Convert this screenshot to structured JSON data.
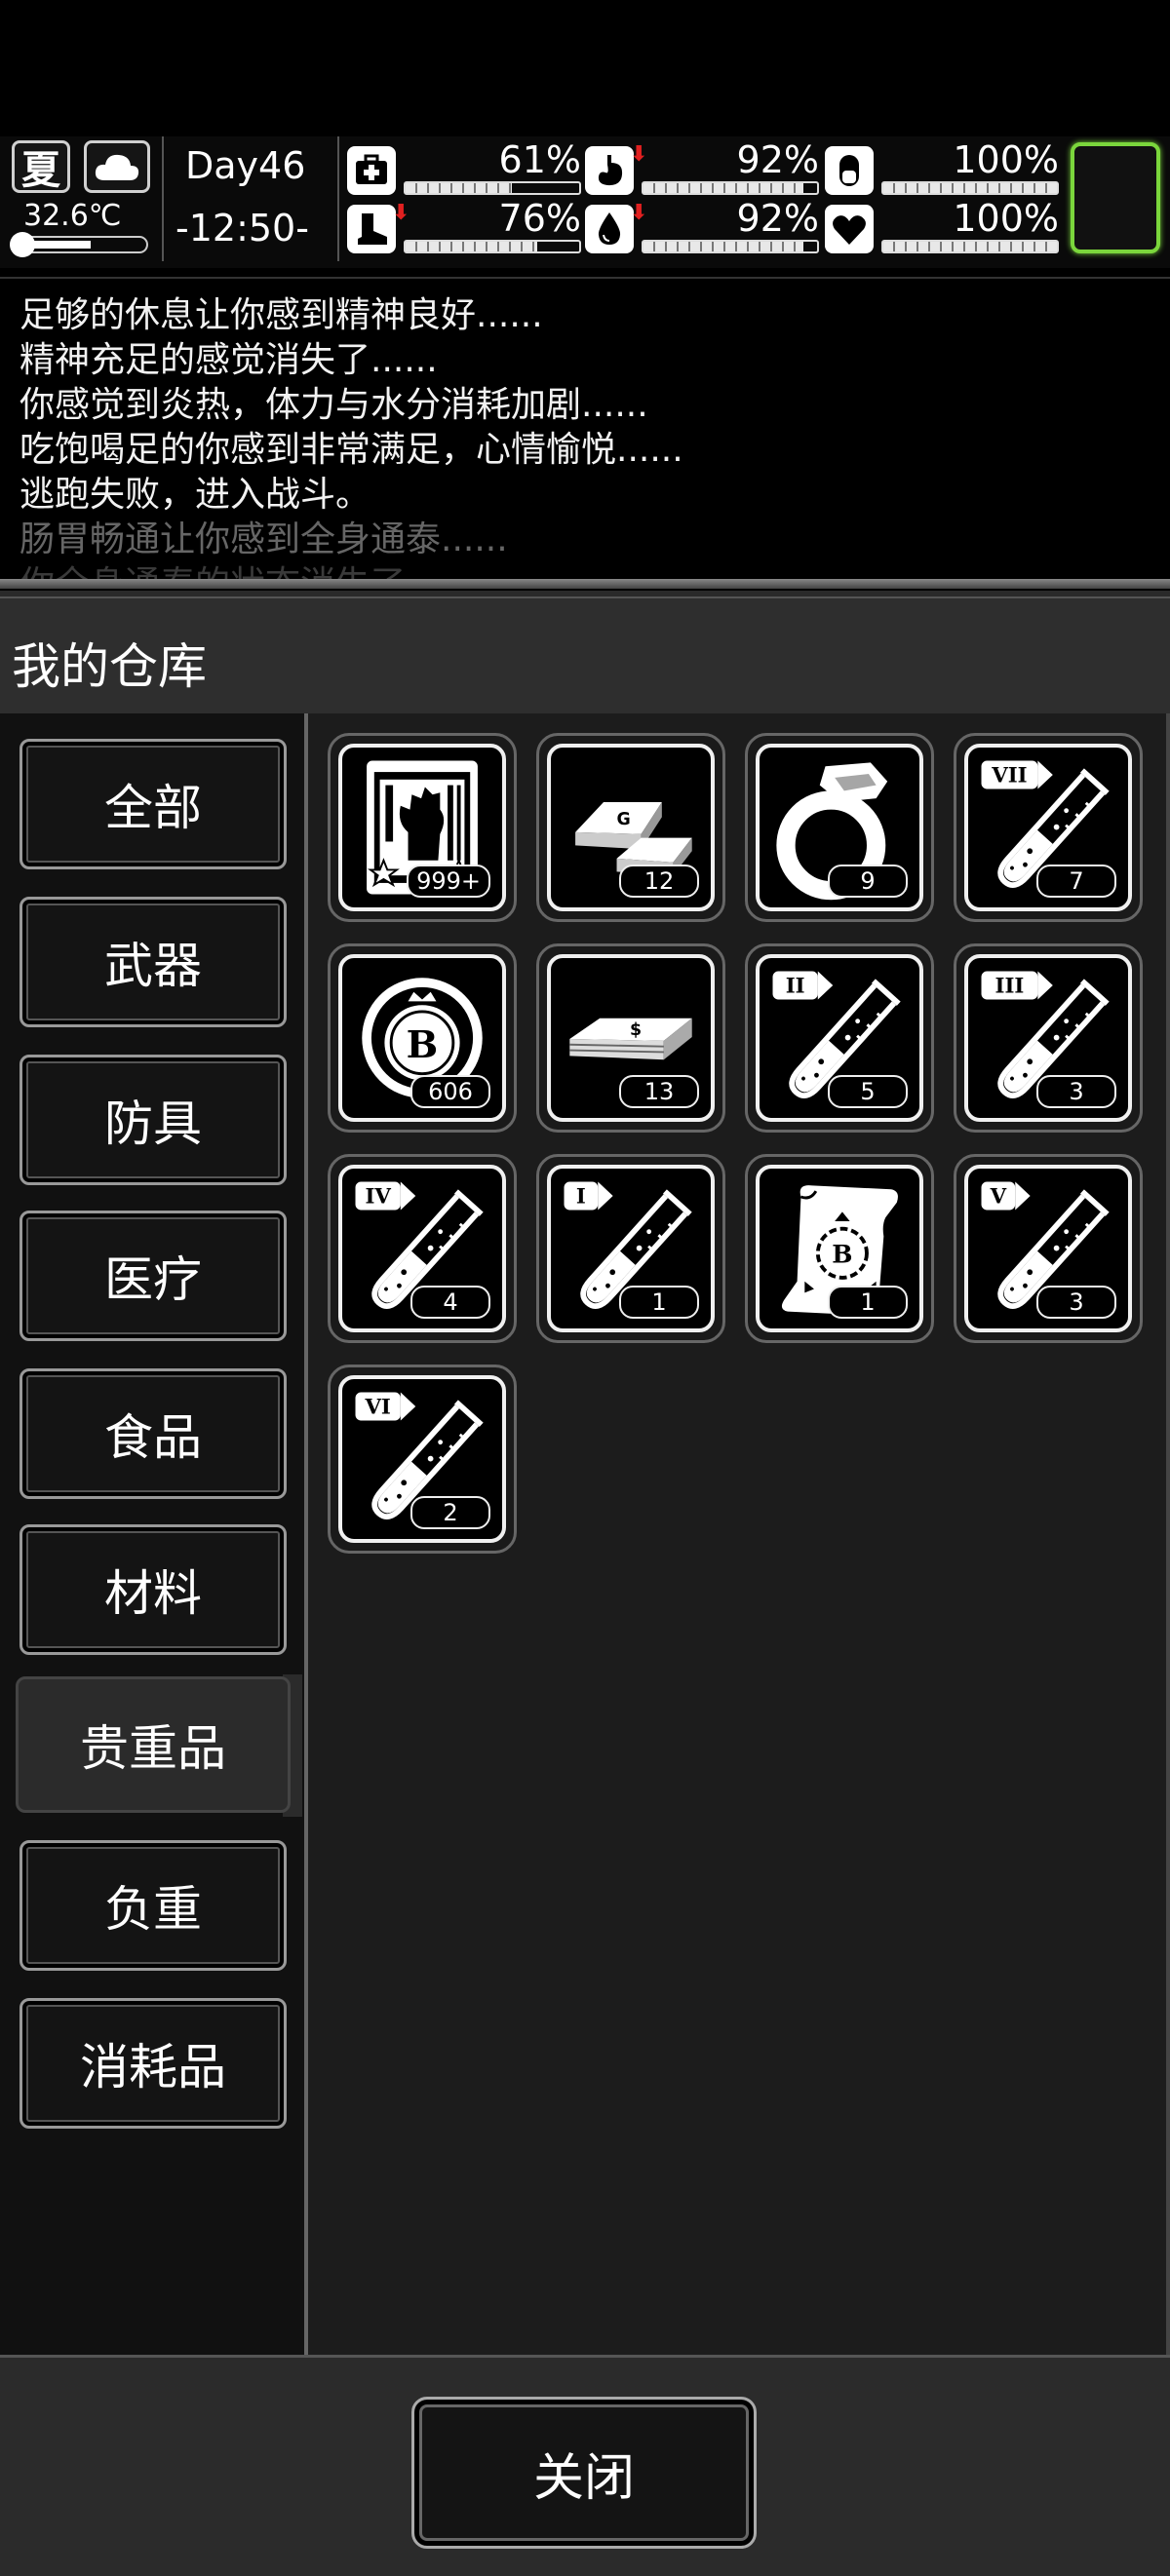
{
  "hud": {
    "season": "夏",
    "weather_icon": "cloud-icon",
    "temperature": "32.6℃",
    "thermo_level": 0.55,
    "day": "Day46",
    "clock": "-12:50-",
    "stats": [
      {
        "name": "health",
        "icon": "medkit-icon",
        "value": "61%",
        "level": 0.61,
        "down": false
      },
      {
        "name": "hunger",
        "icon": "stomach-icon",
        "value": "92%",
        "level": 0.92,
        "down": true
      },
      {
        "name": "pill",
        "icon": "pill-icon",
        "value": "100%",
        "level": 1.0,
        "down": false
      },
      {
        "name": "stamina",
        "icon": "boot-icon",
        "value": "76%",
        "level": 0.76,
        "down": true
      },
      {
        "name": "thirst",
        "icon": "water-drop-icon",
        "value": "92%",
        "level": 0.92,
        "down": true
      },
      {
        "name": "mood",
        "icon": "heart-icon",
        "value": "100%",
        "level": 1.0,
        "down": false
      }
    ],
    "accent_color": "#7bd63c",
    "arrow_color": "#e02020"
  },
  "log": [
    "足够的休息让你感到精神良好......",
    "精神充足的感觉消失了......",
    "你感觉到炎热，体力与水分消耗加剧......",
    "吃饱喝足的你感到非常满足，心情愉悦......",
    "逃跑失败，进入战斗。",
    "肠胃畅通让你感到全身通泰......",
    "你全身通泰的状态消失了。"
  ],
  "panel": {
    "title": "我的仓库",
    "categories": [
      "全部",
      "武器",
      "防具",
      "医疗",
      "食品",
      "材料",
      "贵重品",
      "负重",
      "消耗品"
    ],
    "active_category": "贵重品",
    "close_label": "关闭"
  },
  "items": [
    {
      "icon": "zombie-card-icon",
      "count": "999+"
    },
    {
      "icon": "gold-bars-icon",
      "count": "12"
    },
    {
      "icon": "diamond-ring-icon",
      "count": "9"
    },
    {
      "icon": "test-tube-vii-icon",
      "label": "VII",
      "count": "7"
    },
    {
      "icon": "b-coin-chip-icon",
      "count": "606"
    },
    {
      "icon": "cash-stack-icon",
      "count": "13"
    },
    {
      "icon": "test-tube-ii-icon",
      "label": "II",
      "count": "5"
    },
    {
      "icon": "test-tube-iii-icon",
      "label": "III",
      "count": "3"
    },
    {
      "icon": "test-tube-iv-icon",
      "label": "IV",
      "count": "4"
    },
    {
      "icon": "test-tube-i-icon",
      "label": "I",
      "count": "1"
    },
    {
      "icon": "blueprint-scroll-icon",
      "count": "1"
    },
    {
      "icon": "test-tube-v-icon",
      "label": "V",
      "count": "3"
    },
    {
      "icon": "test-tube-vi-icon",
      "label": "VI",
      "count": "2"
    }
  ]
}
